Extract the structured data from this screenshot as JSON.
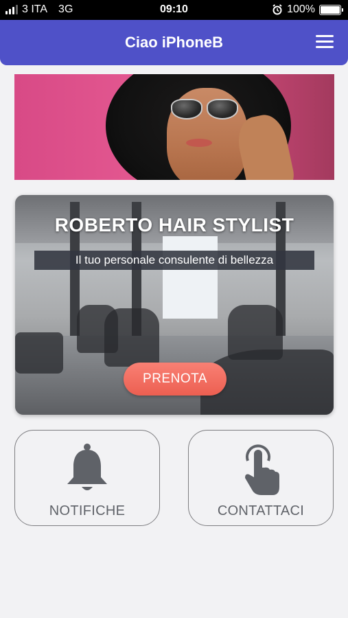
{
  "status_bar": {
    "carrier": "3 ITA",
    "network": "3G",
    "time": "09:10",
    "battery": "100%",
    "battery_level": 1.0
  },
  "header": {
    "title": "Ciao iPhoneB",
    "menu_icon": "hamburger-menu-icon"
  },
  "salon": {
    "title": "ROBERTO HAIR STYLIST",
    "subtitle": "Il tuo personale consulente di bellezza",
    "book_label": "PRENOTA"
  },
  "actions": {
    "notifications_label": "NOTIFICHE",
    "notifications_icon": "bell-icon",
    "contact_label": "CONTATTACI",
    "contact_icon": "tap-hand-icon"
  },
  "colors": {
    "header": "#4f51c8",
    "book_button": "#ef6757",
    "icon_gray": "#5f6268",
    "background": "#f2f2f4"
  }
}
